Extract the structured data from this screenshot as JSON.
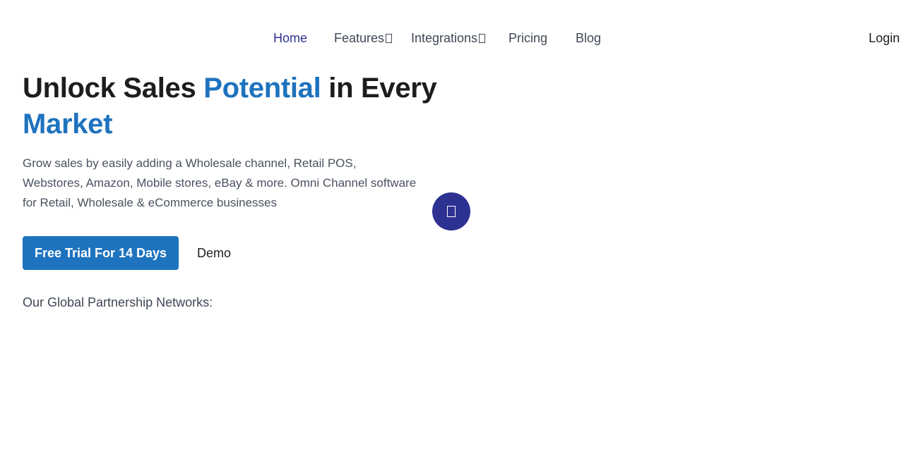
{
  "nav": {
    "home": "Home",
    "features": "Features",
    "integrations": "Integrations",
    "pricing": "Pricing",
    "blog": "Blog",
    "login": "Login",
    "dropdown_icon": "missing-glyph-box"
  },
  "hero": {
    "title_part1": "Unlock Sales ",
    "title_accent1": "Potential",
    "title_part2": " in Every ",
    "title_accent2": "Market",
    "description": "Grow sales by easily adding a Wholesale channel, Retail POS, Webstores, Amazon, Mobile stores, eBay & more. Omni Channel software for Retail, Wholesale & eCommerce businesses",
    "trial_button": "Free Trial For 14 Days",
    "demo_link": "Demo",
    "partners_label": "Our Global Partnership Networks:"
  },
  "floating_button": {
    "icon": "missing-glyph-box"
  },
  "colors": {
    "accent": "#1e73be",
    "brand_dark": "#2d3192",
    "heading": "#1d1d1f",
    "body_text": "#4a5260"
  }
}
